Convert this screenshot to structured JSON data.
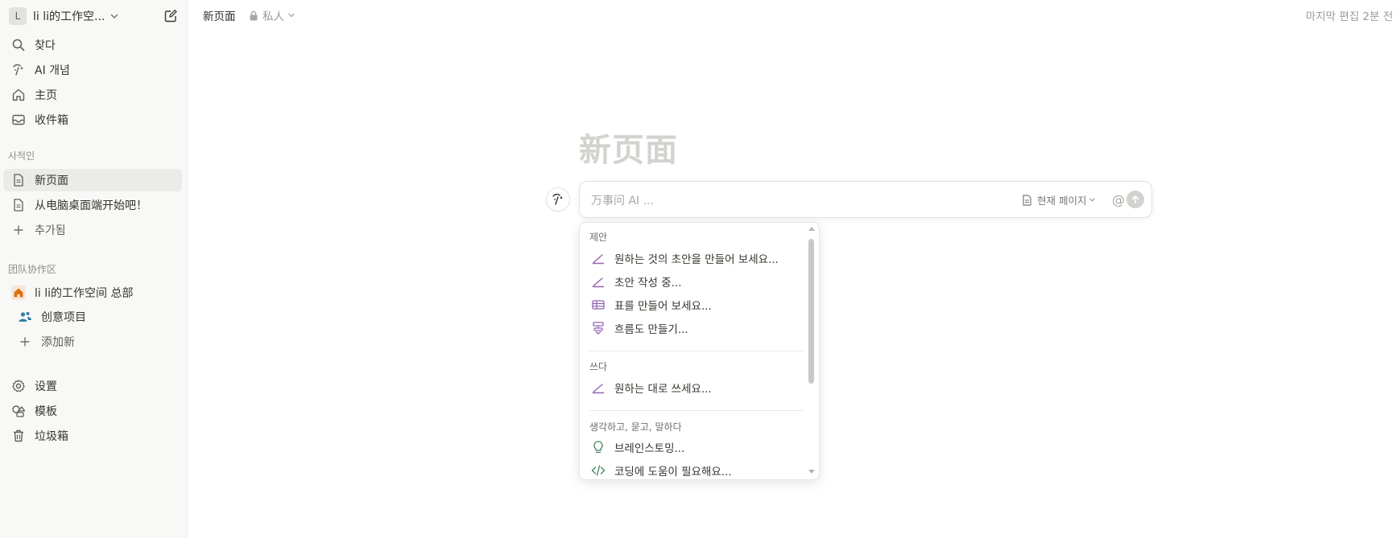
{
  "workspace": {
    "initial": "L",
    "name": "li li的工作空..."
  },
  "sidebar": {
    "top_items": [
      {
        "label": "찾다",
        "icon": "search-icon"
      },
      {
        "label": "AI 개념",
        "icon": "ai-face-icon"
      },
      {
        "label": "主页",
        "icon": "home-icon"
      },
      {
        "label": "收件箱",
        "icon": "inbox-icon"
      }
    ],
    "private_section": "사적인",
    "private_items": [
      {
        "label": "新页面",
        "icon": "page-icon",
        "active": true
      },
      {
        "label": "从电脑桌面端开始吧！",
        "icon": "page-icon"
      },
      {
        "label": "추가됨",
        "icon": "plus-icon"
      }
    ],
    "team_section": "团队协作区",
    "team_items": [
      {
        "label": "li li的工作空间 总部",
        "icon": "home-icon"
      },
      {
        "label": "创意项目",
        "icon": "people-icon"
      },
      {
        "label": "添加新",
        "icon": "plus-icon"
      }
    ],
    "bottom_items": [
      {
        "label": "设置",
        "icon": "gear-icon"
      },
      {
        "label": "模板",
        "icon": "shapes-icon"
      },
      {
        "label": "垃圾箱",
        "icon": "trash-icon"
      }
    ]
  },
  "topbar": {
    "breadcrumb": "新页面",
    "privacy": "私人",
    "last_edit": "마지막 편집 2분 전"
  },
  "page": {
    "title": "新页面"
  },
  "ai": {
    "placeholder": "万事问 AI ...",
    "context_label": "현재 페이지",
    "at_symbol": "@"
  },
  "menu": {
    "sections": [
      {
        "heading": "제안",
        "items": [
          {
            "label": "원하는 것의 초안을 만들어 보세요...",
            "icon": "pen-icon"
          },
          {
            "label": "초안 작성 중...",
            "icon": "pen-icon"
          },
          {
            "label": "표를 만들어 보세요...",
            "icon": "table-icon"
          },
          {
            "label": "흐름도 만들기...",
            "icon": "flowchart-icon"
          }
        ]
      },
      {
        "heading": "쓰다",
        "items": [
          {
            "label": "원하는 대로 쓰세요...",
            "icon": "pen-icon"
          }
        ]
      },
      {
        "heading": "생각하고, 묻고, 말하다",
        "items": [
          {
            "label": "브레인스토밍...",
            "icon": "lightbulb-icon"
          },
          {
            "label": "코딩에 도움이 필요해요...",
            "icon": "code-icon"
          }
        ]
      }
    ]
  },
  "colors": {
    "accent_purple": "#9065b0",
    "accent_green": "#448361",
    "team_orange": "#d9730d",
    "people_blue": "#337ea9"
  }
}
